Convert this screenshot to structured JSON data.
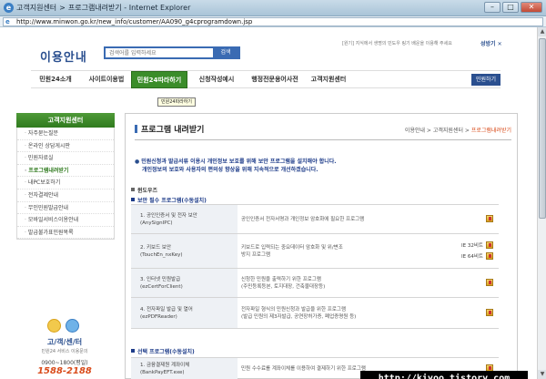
{
  "window": {
    "title_context": "고객지원센터",
    "title_page": "프로그램내려받기",
    "title_app": "Internet Explorer",
    "url": "http://www.minwon.go.kr/new_info/customer/AA090_g4cprogramdown.jsp",
    "buttons": {
      "minimize": "–",
      "maximize": "□",
      "close": "✕"
    }
  },
  "header": {
    "logo": "이용안내",
    "search_placeholder": "검색어를 입력하세요",
    "search_button": "검색",
    "top_note": "[원기] 지식에서 생명의 민도우 링기 배운을 이용해 주세요",
    "font_control": "성방기 ✕"
  },
  "gnb": {
    "items": [
      {
        "label": "민원24소개"
      },
      {
        "label": "사이트이용법"
      },
      {
        "label": "민원24따라하기"
      },
      {
        "label": "신청작성예시"
      },
      {
        "label": "행정전문용어사전"
      },
      {
        "label": "고객지원센터"
      }
    ],
    "login": "민원하기",
    "tooltip": "민원24따라하기"
  },
  "lnb": {
    "title": "고객지원센터",
    "items": [
      "자주묻는질문",
      "온라인 상담게시판",
      "민원자료실",
      "프로그램내려받기",
      "내PC보호하기",
      "전자결제안내",
      "무인민원발급안내",
      "모바일서비스이용안내",
      "발급불가표민원목록"
    ],
    "active_index": 3
  },
  "callcenter": {
    "title": "고/객/센/터",
    "subtitle": "민원24 서비스 이용문의",
    "hours": "0900~1800(평일)",
    "phone": "1588-2188"
  },
  "content": {
    "title": "프로그램 내려받기",
    "breadcrumb": {
      "b1": "이용안내",
      "sep": " > ",
      "b2": "고객지원센터",
      "b3": "프로그램내려받기"
    },
    "notice_line1": "민원신청과 발급서류 이용시 개인정보 보호를 위해 보안 프로그램을 설치해야 합니다.",
    "notice_line2": "개인정보의 보호와 사용자의 편의성 향상을 위해 지속적으로 개선하겠습니다.",
    "os_label": "윈도우즈",
    "required_label": "보안 필수 프로그램(수동설치)",
    "optional_label": "선택 프로그램(수동설치)",
    "required_rows": [
      {
        "name1": "1. 공인인증서 및 전자 보안",
        "name2": "(AnySignIPC)",
        "desc1": "공인인증서 전자서명과 개인정보 암호화에 필요한 프로그램",
        "desc2": "",
        "dl": [
          ""
        ]
      },
      {
        "name1": "2. 키보드 보안",
        "name2": "(TouchEn_nxKey)",
        "desc1": "키보드로 입력되는 중요데이터 암호화 및 위/변조",
        "desc2": "방지 프로그램",
        "dl": [
          "IE 32비트",
          "IE 64비트"
        ]
      },
      {
        "name1": "3. 인터넷 민원발급",
        "name2": "(ezCertForClient)",
        "desc1": "신청한 민원을 출력하기 위한 프로그램",
        "desc2": "(주민등록등본, 토지대장, 건축물대장등)",
        "dl": [
          ""
        ]
      },
      {
        "name1": "4. 전자파일 발급 및 열어",
        "name2": "(ezPDFReader)",
        "desc1": "전자파일 형식의 민원신청과 발급을 위한 프로그램",
        "desc2": "(발급 민원의 제3자발급, 공연장허가증, 폐업증명원 등)",
        "dl": [
          ""
        ]
      }
    ],
    "optional_rows": [
      {
        "name1": "1. 금융결제원 계좌이체",
        "name2": "(BankPayEFT.exe)",
        "desc1": "민원 수수료를 계좌이체를 이용하여 결제하기 위한 프로그램",
        "desc2": "",
        "dl": [
          ""
        ]
      }
    ]
  },
  "watermark": "http://kiyoo.tistory.com"
}
